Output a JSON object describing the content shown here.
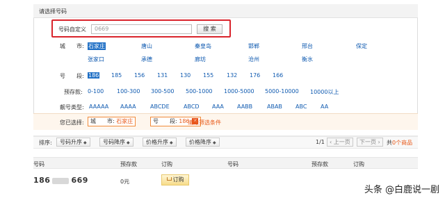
{
  "panel": {
    "title": "请选择号码"
  },
  "search": {
    "label": "号码自定义",
    "value": "0669",
    "button": "搜 索"
  },
  "city": {
    "label": "城　　市:",
    "row1": [
      "石家庄",
      "唐山",
      "秦皇岛",
      "邯郸",
      "邢台",
      "保定"
    ],
    "row2": [
      "张家口",
      "承德",
      "廊坊",
      "沧州",
      "衡水"
    ]
  },
  "segment": {
    "label": "号　　段:",
    "items": [
      "186",
      "185",
      "156",
      "131",
      "130",
      "155",
      "132",
      "176",
      "166"
    ]
  },
  "deposit": {
    "label": "预存款:",
    "items": [
      "0-100",
      "100-300",
      "300-500",
      "500-1000",
      "1000-5000",
      "5000-10000",
      "10000以上"
    ]
  },
  "pattern": {
    "label": "靓号类型:",
    "items": [
      "AAAAA",
      "AAAA",
      "ABCDE",
      "ABCD",
      "AAA",
      "AABB",
      "ABAB",
      "ABC",
      "AA"
    ]
  },
  "filters": {
    "label": "您已选择:",
    "city_key": "城　　市:",
    "city_val": "石家庄",
    "seg_key": "号　　段:",
    "seg_val": "186",
    "remove_icon": "close-icon",
    "clear": "清除筛选条件"
  },
  "sort": {
    "label": "排序:",
    "buttons": [
      "号码升序",
      "号码降序",
      "价格升序",
      "价格降序"
    ]
  },
  "pager": {
    "page": "1/1",
    "prev": "上一页",
    "next": "下一页",
    "total_prefix": "共",
    "total_count": "0",
    "total_suffix": "个商品"
  },
  "table": {
    "headers": [
      "号码",
      "预存款",
      "订购",
      "号码",
      "预存款",
      "订购"
    ],
    "row": {
      "prefix": "186",
      "suffix": "669",
      "price": "0元",
      "buy": "订购"
    }
  },
  "watermark": "头条 @白鹿说一剧",
  "colors": {
    "accent_red": "#d9232b",
    "link_blue": "#0f5ab0",
    "highlight_orange": "#e85a1a"
  }
}
